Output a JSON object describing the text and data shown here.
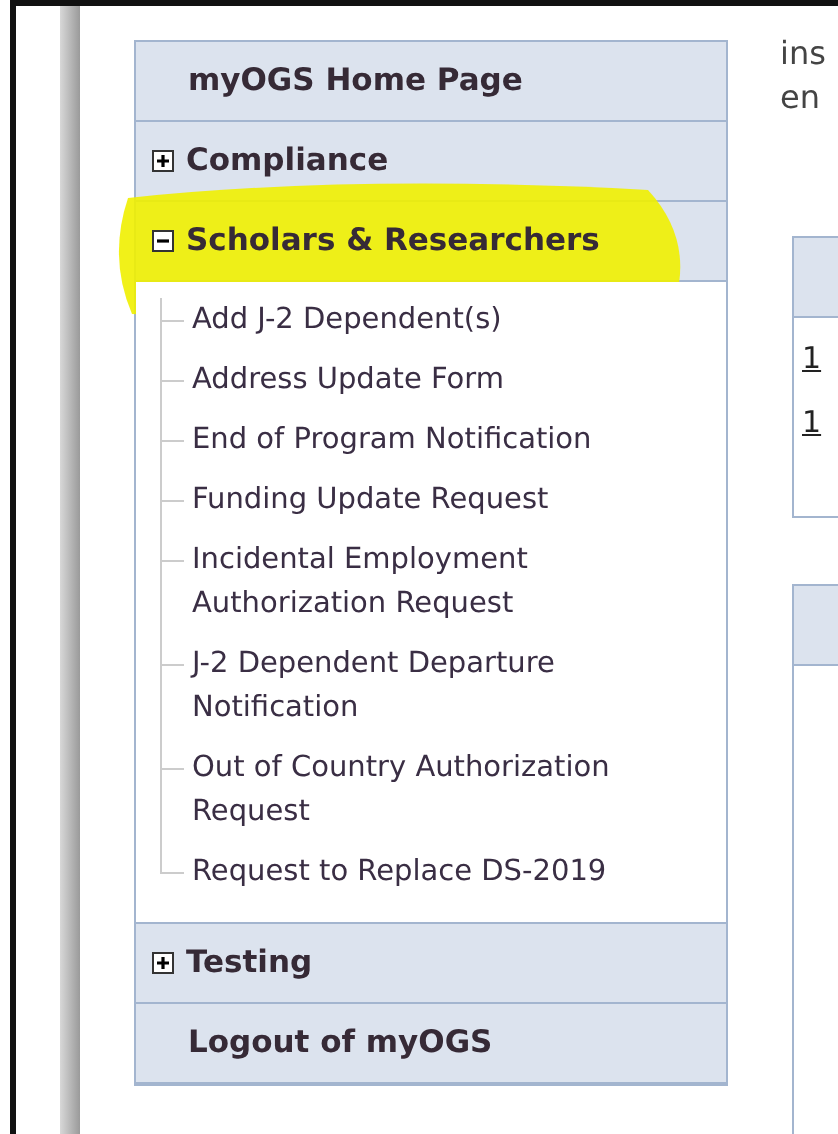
{
  "menu": [
    {
      "label": "myOGS Home Page",
      "kind": "link"
    },
    {
      "label": "Compliance",
      "kind": "section",
      "expanded": false,
      "highlighted": false
    },
    {
      "label": "Scholars & Researchers",
      "kind": "section",
      "expanded": true,
      "highlighted": true,
      "children": [
        {
          "label": "Add J-2 Dependent(s)"
        },
        {
          "label": "Address Update Form"
        },
        {
          "label": "End of Program Notification"
        },
        {
          "label": "Funding Update Request"
        },
        {
          "label": "Incidental Employment Authorization Request"
        },
        {
          "label": "J-2 Dependent Departure Notification"
        },
        {
          "label": "Out of Country Authorization Request"
        },
        {
          "label": "Request to Replace DS-2019"
        }
      ]
    },
    {
      "label": "Testing",
      "kind": "section",
      "expanded": false,
      "highlighted": false
    },
    {
      "label": "Logout of myOGS",
      "kind": "link"
    }
  ],
  "content": {
    "intro_lines": [
      "ins",
      "en"
    ],
    "panel_links": [
      "1",
      "1"
    ]
  }
}
